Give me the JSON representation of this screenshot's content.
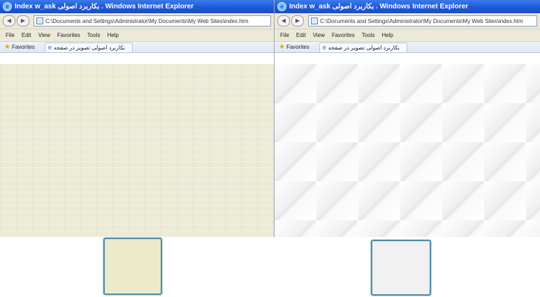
{
  "windows": [
    {
      "title": "Index w_ask بکاربرد اصولی . Windows Internet Explorer",
      "address": "C:\\Documents and Settings\\Administrator\\My Documents\\My Web Sites\\index.htm",
      "menu": [
        "File",
        "Edit",
        "View",
        "Favorites",
        "Tools",
        "Help"
      ],
      "favorites_label": "Favorites",
      "tab_label": "بکاربرد اصولی تصویر در صفحه"
    },
    {
      "title": "Index w_ask بکاربرد اصولی . Windows Internet Explorer",
      "address": "C:\\Documents and Settings\\Administrator\\My Documents\\My Web Sites\\index.htm",
      "menu": [
        "File",
        "Edit",
        "View",
        "Favorites",
        "Tools",
        "Help"
      ],
      "favorites_label": "Favorites",
      "tab_label": "بکاربرد اصولی تصویر در صفحه"
    }
  ],
  "icons": {
    "ie": "ie-icon",
    "back": "back-arrow-icon",
    "forward": "forward-arrow-icon",
    "page": "page-icon",
    "star": "star-icon"
  },
  "colors": {
    "titlebar": "#1d58d8",
    "left_background": "#ecebd6",
    "right_background": "#f7f7f7",
    "swatch_border": "#4f8ea8"
  }
}
